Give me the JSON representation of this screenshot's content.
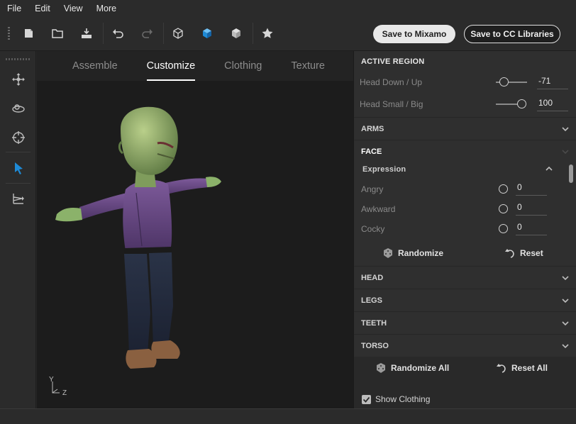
{
  "menu": {
    "file": "File",
    "edit": "Edit",
    "view": "View",
    "more": "More"
  },
  "toolbar": {
    "save_mixamo": "Save to Mixamo",
    "save_cc": "Save to CC Libraries",
    "accent_color": "#1e8ad6"
  },
  "tabs": [
    "Assemble",
    "Customize",
    "Clothing",
    "Texture"
  ],
  "viewport": {
    "axis_y": "Y",
    "axis_z": "Z"
  },
  "panel": {
    "active_region": "ACTIVE REGION",
    "head_down_up": {
      "label": "Head Down / Up",
      "value": "-71",
      "level": 0.1
    },
    "head_small_big": {
      "label": "Head Small / Big",
      "value": "100",
      "level": 1.0
    },
    "arms": "ARMS",
    "face": "FACE",
    "expression": "Expression",
    "expr_items": [
      {
        "label": "Angry",
        "value": "0"
      },
      {
        "label": "Awkward",
        "value": "0"
      },
      {
        "label": "Cocky",
        "value": "0"
      }
    ],
    "randomize": "Randomize",
    "reset": "Reset",
    "head": "HEAD",
    "legs": "LEGS",
    "teeth": "TEETH",
    "torso": "TORSO",
    "randomize_all": "Randomize All",
    "reset_all": "Reset All",
    "show_clothing": "Show Clothing"
  }
}
